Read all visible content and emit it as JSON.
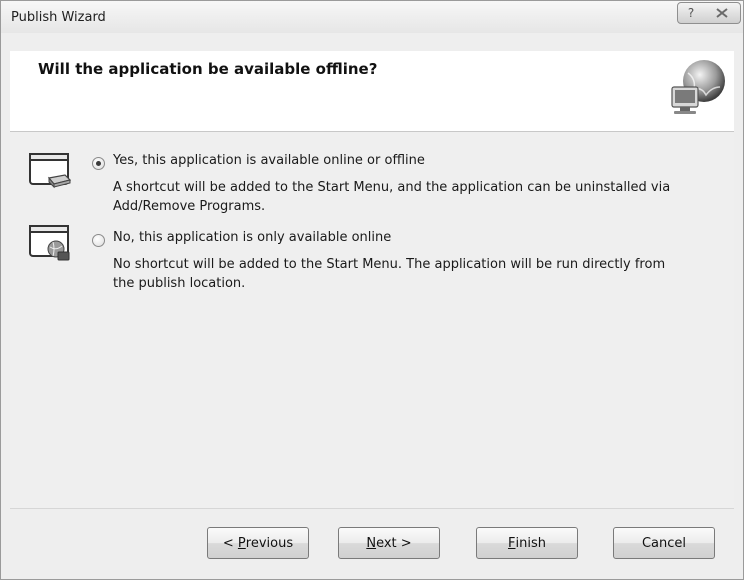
{
  "window": {
    "title": "Publish Wizard",
    "help_glyph": "?",
    "help_icon": "help-icon",
    "close_icon": "close-icon"
  },
  "header": {
    "title": "Will the application be available offline?",
    "icon": "globe-computer-icon"
  },
  "options": [
    {
      "label": "Yes, this application is available online or offline",
      "description": "A shortcut will be added to the Start Menu, and the application can be uninstalled via Add/Remove Programs.",
      "selected": true,
      "icon": "offline-desktop-icon"
    },
    {
      "label": "No, this application is only available online",
      "description": "No shortcut will be added to the Start Menu. The application will be run directly from the publish location.",
      "selected": false,
      "icon": "online-web-icon"
    }
  ],
  "buttons": {
    "previous": {
      "prefix": "< ",
      "mnemonic": "P",
      "rest": "revious"
    },
    "next": {
      "mnemonic": "N",
      "rest": "ext >"
    },
    "finish": {
      "mnemonic": "F",
      "rest": "inish"
    },
    "cancel": "Cancel"
  },
  "colors": {
    "dialog_bg": "#efefef",
    "header_bg": "#ffffff",
    "border": "#9a9a9a"
  }
}
